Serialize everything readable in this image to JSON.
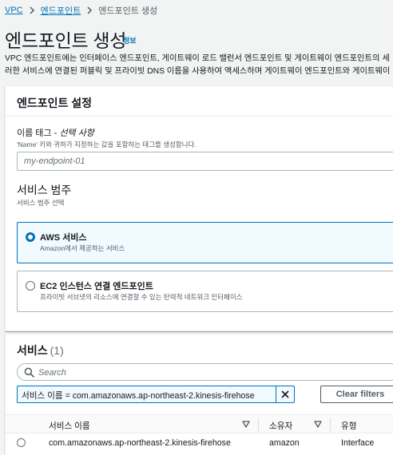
{
  "breadcrumb": {
    "items": [
      "VPC",
      "엔드포인트"
    ],
    "current": "엔드포인트 생성"
  },
  "page": {
    "title": "엔드포인트 생성",
    "info_link": "정보",
    "description_line1": "VPC 엔드포인트에는 인터페이스 엔드포인트, 게이트웨이 로드 밸런서 엔드포인트 및 게이트웨이 엔드포인트의 세",
    "description_line2": "러한 서비스에 연결된 퍼블릭 및 프라이빗 DNS 이름을 사용하여 액세스하며 게이트웨이 엔드포인트와 게이트웨이"
  },
  "endpoint_settings": {
    "header": "엔드포인트 설정",
    "name_tag_label": "이름 태그 - ",
    "name_tag_optional": "선택 사항",
    "name_tag_hint": "'Name' 키와 귀하가 지정하는 값을 포함하는 태그를 생성합니다.",
    "name_tag_placeholder": "my-endpoint-01",
    "category_title": "서비스 범주",
    "category_hint": "서비스 범주 선택",
    "options": [
      {
        "title": "AWS 서비스",
        "description": "Amazon에서 제공하는 서비스",
        "selected": true
      },
      {
        "title": "EC2 인스턴스 연결 엔드포인트",
        "description": "프라이빗 서브넷의 리소스에 연결할 수 있는 탄력적 네트워크 인터페이스",
        "selected": false
      }
    ]
  },
  "services": {
    "header": "서비스",
    "count": "(1)",
    "search_placeholder": "Search",
    "filter_token": "서비스 이름 = com.amazonaws.ap-northeast-2.kinesis-firehose",
    "clear_filters": "Clear filters",
    "columns": [
      "서비스 이름",
      "소유자",
      "유형"
    ],
    "rows": [
      {
        "service_name": "com.amazonaws.ap-northeast-2.kinesis-firehose",
        "owner": "amazon",
        "type": "Interface"
      }
    ]
  },
  "colors": {
    "accent": "#0073bb",
    "background": "#f2f3f3",
    "text": "#16191f"
  }
}
